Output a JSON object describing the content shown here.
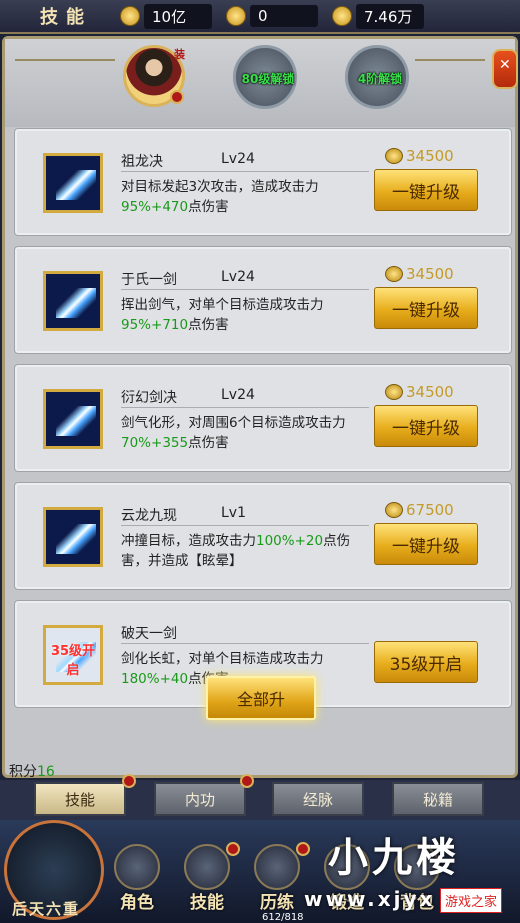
{
  "topbar": {
    "title": "技能",
    "gold": "10亿",
    "bound_gold": "0",
    "coins": "7.46万"
  },
  "header": {
    "avatar_tag": "装",
    "slot2": "80级解锁",
    "slot3": "4阶解锁"
  },
  "skills": [
    {
      "name": "祖龙决",
      "level": "Lv24",
      "desc": "对目标发起3次攻击，造成攻击力",
      "pct": "95%+470",
      "desc_end": "点伤害",
      "cost": "34500",
      "button": "一键升级",
      "icon_text": ""
    },
    {
      "name": "于氏一剑",
      "level": "Lv24",
      "desc": "挥出剑气，对单个目标造成攻击力",
      "pct": "95%+710",
      "desc_end": "点伤害",
      "cost": "34500",
      "button": "一键升级",
      "icon_text": ""
    },
    {
      "name": "衍幻剑决",
      "level": "Lv24",
      "desc": "剑气化形，对周围6个目标造成攻击力",
      "pct": "70%+355",
      "desc_end": "点伤害",
      "cost": "34500",
      "button": "一键升级",
      "icon_text": ""
    },
    {
      "name": "云龙九现",
      "level": "Lv1",
      "desc": "冲撞目标，造成攻击力",
      "pct": "100%+20",
      "desc_end": "点伤害，并造成【眩晕】",
      "cost": "67500",
      "button": "一键升级",
      "icon_text": ""
    },
    {
      "name": "破天一剑",
      "level": "",
      "desc": "剑化长虹，对单个目标造成攻击力",
      "pct": "180%+40",
      "desc_end": "点伤害",
      "cost": "",
      "button": "35级开启",
      "icon_text": "35级开启"
    }
  ],
  "actions": {
    "upgrade_all": "全部升",
    "points_label": "积分",
    "points_value": "16"
  },
  "tabs": [
    "技能",
    "内功",
    "经脉",
    "秘籍"
  ],
  "bottom": {
    "emblem_label": "后天六重",
    "nav": [
      "角色",
      "技能",
      "历练",
      "锻造",
      "背包"
    ],
    "exp": "612/818"
  },
  "watermark": {
    "brand": "小九楼",
    "url": "www.xjyx",
    "site": "游戏之家"
  },
  "colors": {
    "gold_button": "#e7ad1c",
    "green_text": "#1a9a1a",
    "frame": "#a99a72"
  }
}
